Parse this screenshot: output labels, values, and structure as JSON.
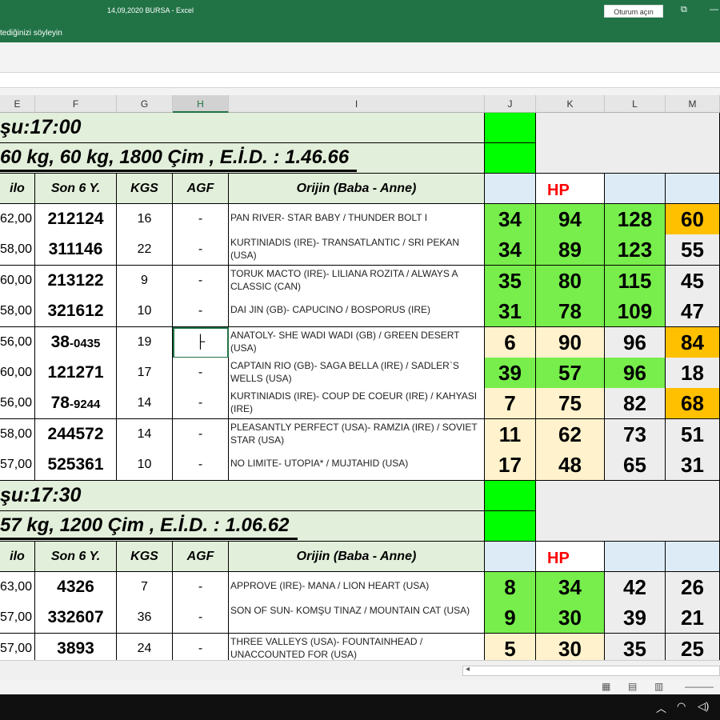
{
  "window": {
    "title": "14,09,2020 BURSA  -  Excel",
    "tellme": "tediğinizi söyleyin",
    "signin": "Oturum açın"
  },
  "columns": [
    "E",
    "F",
    "G",
    "H",
    "I",
    "J",
    "K",
    "L",
    "M"
  ],
  "race1": {
    "title": "şu:17:00",
    "info": " 60 kg, 60 kg, 1800 Çim , E.İ.D. : 1.46.66",
    "headers": {
      "kilo": "ilo",
      "son6": "Son 6 Y.",
      "kgs": "KGS",
      "agf": "AGF",
      "origin": "Orijin (Baba - Anne)",
      "hp": "HP"
    },
    "rows": [
      {
        "kilo": "62,00",
        "son6": "212124",
        "son6_small": "",
        "kgs": "16",
        "agf": "-",
        "origin": "PAN RIVER- STAR BABY / THUNDER BOLT I",
        "j": "34",
        "k": "94",
        "l": "128",
        "m": "60"
      },
      {
        "kilo": "58,00",
        "son6": "311146",
        "son6_small": "",
        "kgs": "22",
        "agf": "-",
        "origin": "KURTINIADIS (IRE)- TRANSATLANTIC / SRI PEKAN (USA)",
        "j": "34",
        "k": "89",
        "l": "123",
        "m": "55"
      },
      {
        "kilo": "60,00",
        "son6": "213122",
        "son6_small": "",
        "kgs": "9",
        "agf": "-",
        "origin": "TORUK MACTO (IRE)- LILIANA ROZITA / ALWAYS A CLASSIC (CAN)",
        "j": "35",
        "k": "80",
        "l": "115",
        "m": "45"
      },
      {
        "kilo": "58,00",
        "son6": "321612",
        "son6_small": "",
        "kgs": "10",
        "agf": "-",
        "origin": "DAI JIN (GB)- CAPUCINO / BOSPORUS (IRE)",
        "j": "31",
        "k": "78",
        "l": "109",
        "m": "47"
      },
      {
        "kilo": "56,00",
        "son6": "38",
        "son6_small": "-0435",
        "kgs": "19",
        "agf": "├",
        "origin": "ANATOLY- SHE WADI WADI (GB) / GREEN DESERT (USA)",
        "j": "6",
        "k": "90",
        "l": "96",
        "m": "84"
      },
      {
        "kilo": "60,00",
        "son6": "121271",
        "son6_small": "",
        "kgs": "17",
        "agf": "-",
        "origin": "CAPTAIN RIO (GB)- SAGA BELLA (IRE) / SADLER`S WELLS (USA)",
        "j": "39",
        "k": "57",
        "l": "96",
        "m": "18"
      },
      {
        "kilo": "56,00",
        "son6": "78",
        "son6_small": "-9244",
        "kgs": "14",
        "agf": "-",
        "origin": "KURTINIADIS (IRE)- COUP DE COEUR (IRE) / KAHYASI (IRE)",
        "j": "7",
        "k": "75",
        "l": "82",
        "m": "68"
      },
      {
        "kilo": "58,00",
        "son6": "244572",
        "son6_small": "",
        "kgs": "14",
        "agf": "-",
        "origin": "PLEASANTLY PERFECT (USA)- RAMZIA (IRE) / SOVIET STAR (USA)",
        "j": "11",
        "k": "62",
        "l": "73",
        "m": "51"
      },
      {
        "kilo": "57,00",
        "son6": "525361",
        "son6_small": "",
        "kgs": "10",
        "agf": "-",
        "origin": "NO LIMITE- UTOPIA* / MUJTAHID (USA)",
        "j": "17",
        "k": "48",
        "l": "65",
        "m": "31"
      }
    ]
  },
  "race2": {
    "title": "şu:17:30",
    "info": " 57 kg, 1200 Çim , E.İ.D. : 1.06.62",
    "headers": {
      "kilo": "ilo",
      "son6": "Son 6 Y.",
      "kgs": "KGS",
      "agf": "AGF",
      "origin": "Orijin (Baba - Anne)",
      "hp": "HP"
    },
    "rows": [
      {
        "kilo": "63,00",
        "son6": "4326",
        "son6_small": "",
        "kgs": "7",
        "agf": "-",
        "origin": "APPROVE (IRE)- MANA / LION HEART (USA)",
        "j": "8",
        "k": "34",
        "l": "42",
        "m": "26"
      },
      {
        "kilo": "57,00",
        "son6": "332607",
        "son6_small": "",
        "kgs": "36",
        "agf": "-",
        "origin": "SON OF SUN- KOMŞU TINAZ / MOUNTAIN CAT (USA)",
        "j": "9",
        "k": "30",
        "l": "39",
        "m": "21"
      },
      {
        "kilo": "57,00",
        "son6": "3893",
        "son6_small": "",
        "kgs": "24",
        "agf": "-",
        "origin": "THREE VALLEYS (USA)- FOUNTAINHEAD / UNACCOUNTED FOR (USA)",
        "j": "5",
        "k": "30",
        "l": "35",
        "m": "25"
      }
    ]
  },
  "colors": {
    "excel_green": "#217346",
    "bright_green": "#00ff00",
    "hp_red": "#ff0000",
    "orange": "#ffc000",
    "cream": "#fff2cc"
  },
  "icons": [
    "restore-icon",
    "minimize-icon",
    "normal-view-icon",
    "page-layout-icon",
    "page-break-icon",
    "chevron-up-icon",
    "wifi-icon",
    "speaker-icon"
  ]
}
